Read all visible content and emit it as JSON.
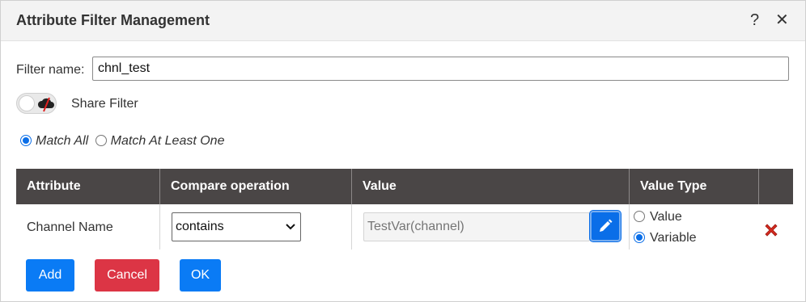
{
  "dialog": {
    "title": "Attribute Filter Management",
    "help_label": "?",
    "close_label": "✕"
  },
  "filter": {
    "label": "Filter name:",
    "value": "chnl_test"
  },
  "share": {
    "label": "Share Filter",
    "enabled": false
  },
  "match": {
    "options": [
      "Match All",
      "Match At Least One"
    ],
    "selected": "Match All"
  },
  "table": {
    "headers": [
      "Attribute",
      "Compare operation",
      "Value",
      "Value Type",
      ""
    ],
    "rows": [
      {
        "attribute": "Channel Name",
        "operation": "contains",
        "value": "TestVar(channel)",
        "value_type_options": [
          "Value",
          "Variable"
        ],
        "value_type_selected": "Variable"
      }
    ]
  },
  "buttons": {
    "add": "Add",
    "cancel": "Cancel",
    "ok": "OK"
  },
  "colors": {
    "primary": "#0a7bf5",
    "danger": "#dc3545",
    "header_bg": "#4a4646",
    "delete_icon": "#d42a1f"
  }
}
